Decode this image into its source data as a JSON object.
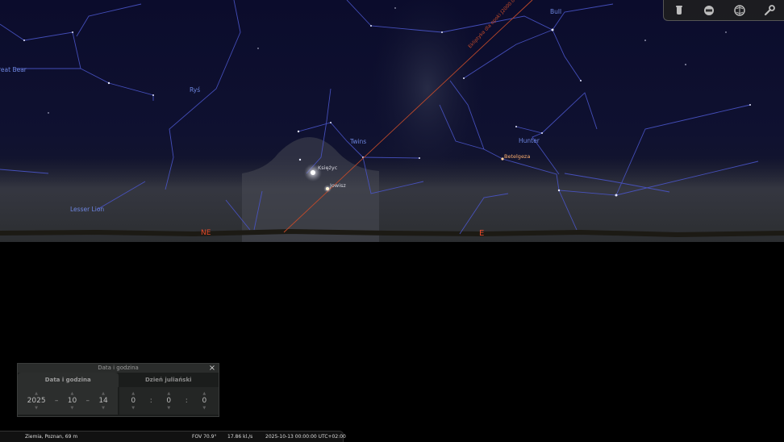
{
  "sky": {
    "constellations": [
      {
        "name": "Great Bear",
        "label": "reat Bear"
      },
      {
        "name": "Lynx",
        "label": "Ryś"
      },
      {
        "name": "Gemini",
        "label": "Twins"
      },
      {
        "name": "Orion",
        "label": "Hunter"
      },
      {
        "name": "Taurus",
        "label": "Bull"
      },
      {
        "name": "Leo Minor",
        "label": "Lesser Lion"
      }
    ],
    "objects": [
      {
        "name": "Moon",
        "label": "Księżyc"
      },
      {
        "name": "Jupiter",
        "label": "Jowisz"
      },
      {
        "name": "Betelgeuse",
        "label": "Betelgeza"
      }
    ],
    "ecliptic_label": "Ekliptyka dla epoki J2000.0",
    "cardinals": [
      {
        "name": "northeast",
        "label": "NE"
      },
      {
        "name": "east",
        "label": "E"
      }
    ],
    "colors": {
      "sky_top": "#0b0c2c",
      "constellation_line": "#4a55c8",
      "constellation_label": "#6e86e0",
      "cardinal": "#e84a2a",
      "ecliptic": "#c04a2a",
      "star_label": "#ffb070"
    }
  },
  "toolbar": {
    "buttons": [
      {
        "name": "sky-layer-icon"
      },
      {
        "name": "observe-icon"
      },
      {
        "name": "location-icon"
      },
      {
        "name": "wrench-icon"
      }
    ]
  },
  "datetime_panel": {
    "title": "Data i godzina",
    "close": "×",
    "tabs": {
      "date": "Data i godzina",
      "julian": "Dzień juliański"
    },
    "date": {
      "year": "2025",
      "month": "10",
      "day": "14",
      "sep": "–"
    },
    "time": {
      "hour": "0",
      "minute": "0",
      "second": "0",
      "sep": ":"
    },
    "spin_up": "▲",
    "spin_down": "▼"
  },
  "status": {
    "location": "Ziemia, Poznan, 69 m",
    "fov": "FOV 70.9°",
    "fps": "17.86 kl./s",
    "datetime": "2025-10-13 00:00:00 UTC+02:00"
  }
}
